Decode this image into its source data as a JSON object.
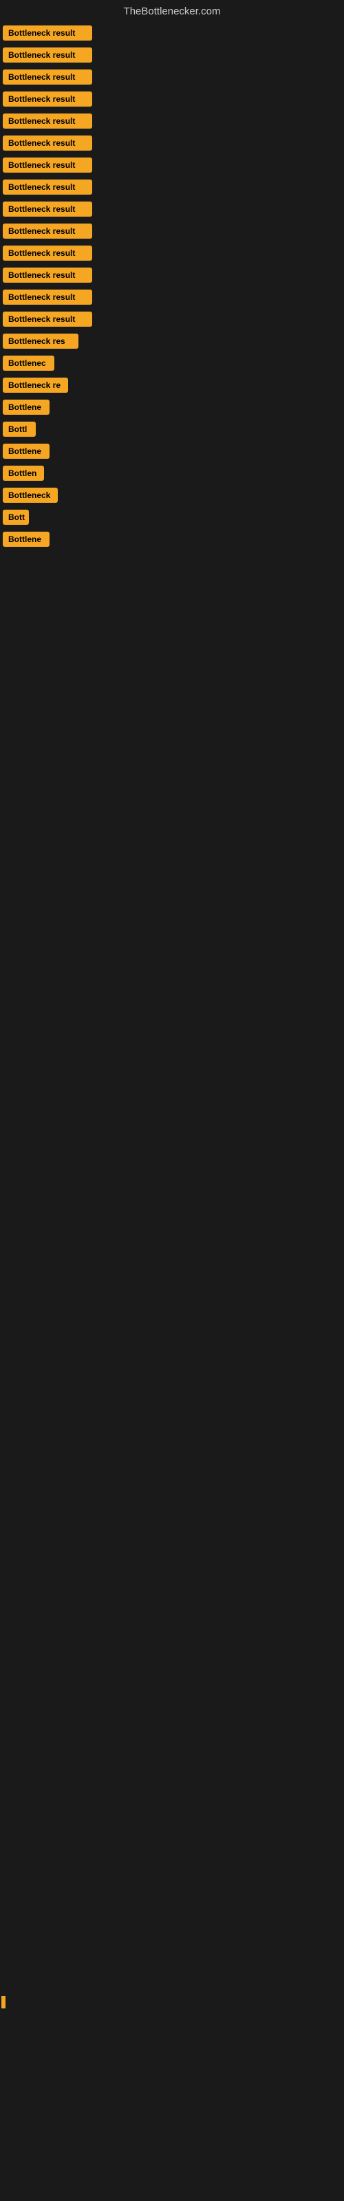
{
  "header": {
    "title": "TheBottlenecker.com"
  },
  "items": [
    {
      "label": "Bottleneck result",
      "width": 130
    },
    {
      "label": "Bottleneck result",
      "width": 130
    },
    {
      "label": "Bottleneck result",
      "width": 130
    },
    {
      "label": "Bottleneck result",
      "width": 130
    },
    {
      "label": "Bottleneck result",
      "width": 130
    },
    {
      "label": "Bottleneck result",
      "width": 130
    },
    {
      "label": "Bottleneck result",
      "width": 130
    },
    {
      "label": "Bottleneck result",
      "width": 130
    },
    {
      "label": "Bottleneck result",
      "width": 130
    },
    {
      "label": "Bottleneck result",
      "width": 130
    },
    {
      "label": "Bottleneck result",
      "width": 130
    },
    {
      "label": "Bottleneck result",
      "width": 130
    },
    {
      "label": "Bottleneck result",
      "width": 130
    },
    {
      "label": "Bottleneck result",
      "width": 130
    },
    {
      "label": "Bottleneck res",
      "width": 110
    },
    {
      "label": "Bottlenec",
      "width": 75
    },
    {
      "label": "Bottleneck re",
      "width": 95
    },
    {
      "label": "Bottlene",
      "width": 68
    },
    {
      "label": "Bottl",
      "width": 48
    },
    {
      "label": "Bottlene",
      "width": 68
    },
    {
      "label": "Bottlen",
      "width": 60
    },
    {
      "label": "Bottleneck",
      "width": 80
    },
    {
      "label": "Bott",
      "width": 38
    },
    {
      "label": "Bottlene",
      "width": 68
    }
  ],
  "accent_color": "#f5a623"
}
